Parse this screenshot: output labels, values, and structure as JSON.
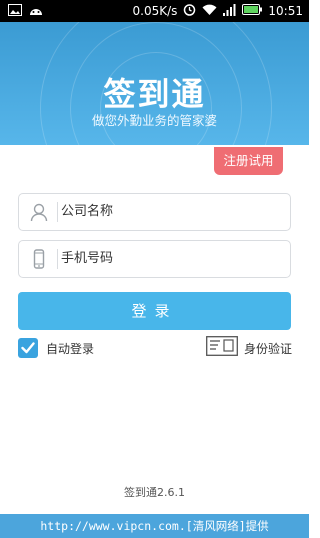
{
  "status_bar": {
    "speed": "0.05K/s",
    "time": "10:51",
    "battery_percent": 100,
    "icons": [
      "image-icon",
      "android-icon",
      "alarm-icon",
      "wifi-icon",
      "signal-icon",
      "battery-icon"
    ]
  },
  "header": {
    "app_name": "签到通",
    "slogan": "做您外勤业务的管家婆"
  },
  "trial_button": {
    "label": "注册试用"
  },
  "form": {
    "company_placeholder": "公司名称",
    "phone_placeholder": "手机号码",
    "login_label": "登录",
    "auto_login_label": "自动登录",
    "auto_login_checked": true,
    "id_verify_label": "身份验证"
  },
  "footer": {
    "version": "签到通2.6.1",
    "watermark": "http://www.vipcn.com.[清风网络]提供"
  },
  "colors": {
    "header_blue": "#4aaee3",
    "primary_blue": "#48b6ea",
    "trial_red": "#ef6d73",
    "watermark_blue": "#4ca5dc"
  }
}
